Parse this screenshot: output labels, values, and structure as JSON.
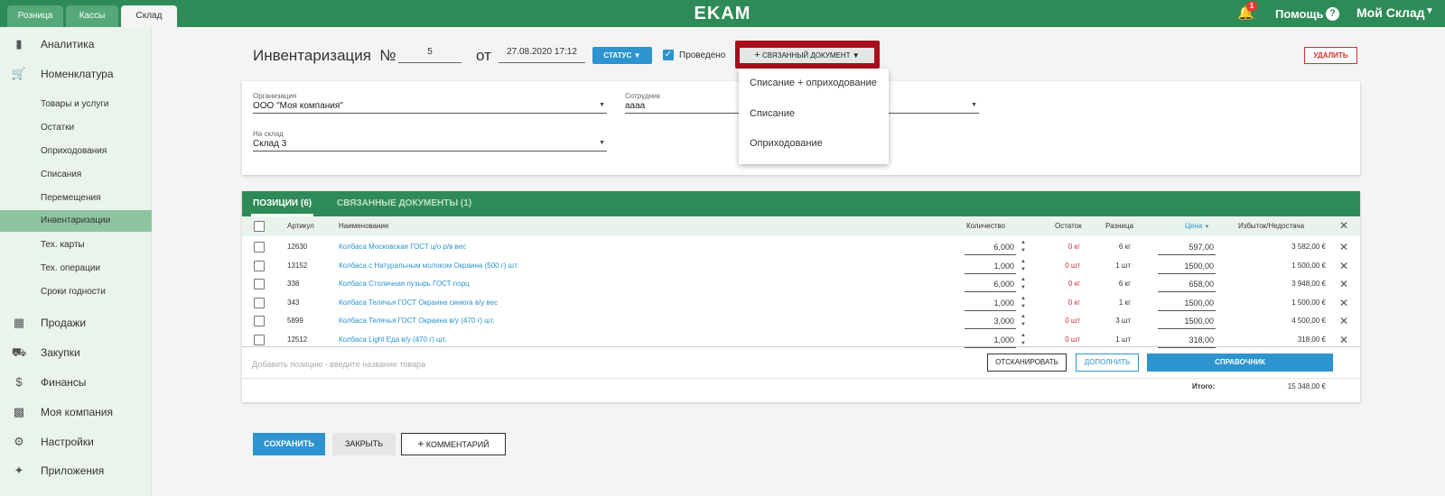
{
  "topbar": {
    "tabs": [
      "Розница",
      "Кассы",
      "Склад"
    ],
    "logo": "EKAM",
    "notification_count": "1",
    "help_label": "Помощь",
    "help_icon": "?",
    "store_label": "Мой Склад"
  },
  "sidebar": {
    "main": [
      {
        "label": "Аналитика",
        "icon": "chart-icon"
      },
      {
        "label": "Номенклатура",
        "icon": "cart-icon"
      }
    ],
    "sub": [
      "Товары и услуги",
      "Остатки",
      "Оприходования",
      "Списания",
      "Перемещения",
      "Инвентаризации",
      "Тех. карты",
      "Тех. операции",
      "Сроки годности"
    ],
    "active_sub": "Инвентаризации",
    "bottom": [
      {
        "label": "Продажи",
        "icon": "store-icon"
      },
      {
        "label": "Закупки",
        "icon": "truck-icon"
      },
      {
        "label": "Финансы",
        "icon": "dollar-icon"
      },
      {
        "label": "Моя компания",
        "icon": "building-icon"
      },
      {
        "label": "Настройки",
        "icon": "gear-icon"
      },
      {
        "label": "Приложения",
        "icon": "puzzle-icon"
      }
    ]
  },
  "header": {
    "title": "Инвентаризация  №",
    "number": "5",
    "from_label": "от",
    "date": "27.08.2020 17:12",
    "status_button": "СТАТУС",
    "proved_label": "Проведено",
    "related_button": "СВЯЗАННЫЙ ДОКУМЕНТ",
    "delete_button": "УДАЛИТЬ"
  },
  "form": {
    "org_label": "Организация",
    "org_value": "ООО \"Моя компания\"",
    "employee_label": "Сотрудник",
    "employee_value": "аааа",
    "warehouse_label": "На склад",
    "warehouse_value": "Склад 3"
  },
  "related_menu": [
    "Списание + оприходование",
    "Списание",
    "Оприходование"
  ],
  "table": {
    "tabs": [
      "ПОЗИЦИИ (6)",
      "СВЯЗАННЫЕ ДОКУМЕНТЫ (1)"
    ],
    "columns": {
      "article": "Артикул",
      "name": "Наименование",
      "qty": "Количество",
      "stock": "Остаток",
      "diff": "Разница",
      "price": "Цена",
      "surplus": "Избыток/Недостача"
    },
    "rows": [
      {
        "article": "12630",
        "name": "Колбаса Московская ГОСТ ц/о р/в вес",
        "qty": "6,000",
        "stock": "0 кг",
        "diff": "6 кг",
        "price": "597,00",
        "surplus": "3 582,00 €"
      },
      {
        "article": "13152",
        "name": "Колбаса с Натуральным молоком Окраина (500 г) шт.",
        "qty": "1,000",
        "stock": "0 шт",
        "diff": "1 шт",
        "price": "1500,00",
        "surplus": "1 500,00 €"
      },
      {
        "article": "338",
        "name": "Колбаса Столичная пузырь ГОСТ порц",
        "qty": "6,000",
        "stock": "0 кг",
        "diff": "6 кг",
        "price": "658,00",
        "surplus": "3 948,00 €"
      },
      {
        "article": "343",
        "name": "Колбаса Телячья ГОСТ Окраина синюга в/у вес",
        "qty": "1,000",
        "stock": "0 кг",
        "diff": "1 кг",
        "price": "1500,00",
        "surplus": "1 500,00 €"
      },
      {
        "article": "5899",
        "name": "Колбаса Телячья ГОСТ Окраина в/у (470 г) шт.",
        "qty": "3,000",
        "stock": "0 шт",
        "diff": "3 шт",
        "price": "1500,00",
        "surplus": "4 500,00 €"
      },
      {
        "article": "12512",
        "name": "Колбаса Light Еда в/у (470 г) шт.",
        "qty": "1,000",
        "stock": "0 шт",
        "diff": "1 шт",
        "price": "318,00",
        "surplus": "318,00 €"
      }
    ],
    "add_placeholder": "Добавить позицию - введите название товара",
    "scan_button": "ОТСКАНИРОВАТЬ",
    "fill_button": "ДОПОЛНИТЬ",
    "catalog_button": "СПРАВОЧНИК",
    "total_label": "Итого:",
    "total_value": "15 348,00 €"
  },
  "footer": {
    "save_button": "СОХРАНИТЬ",
    "close_button": "ЗАКРЫТЬ",
    "comment_button": "КОММЕНТАРИЙ"
  },
  "colors": {
    "brand_green": "#2e8b57",
    "accent_blue": "#2d94cf",
    "danger_red": "#d32f2f",
    "highlight_red": "#a90f1c"
  }
}
